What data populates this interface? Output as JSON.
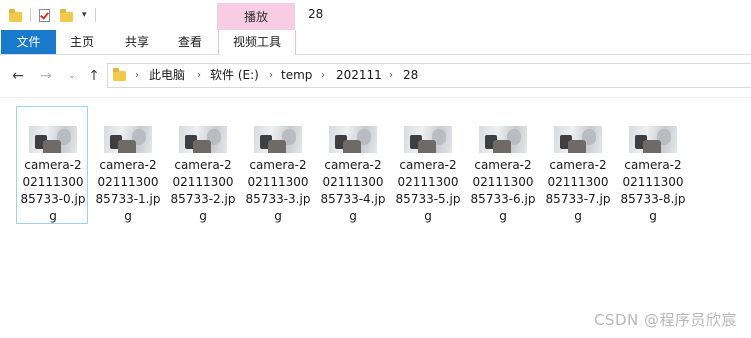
{
  "title_bar": {
    "quick_access": [
      {
        "icon": "folder-icon"
      },
      {
        "icon": "properties-check-icon"
      },
      {
        "icon": "new-folder-icon"
      },
      {
        "icon": "customize-dropdown-icon",
        "glyph": "▾"
      }
    ],
    "context_tab_group": "播放",
    "window_title": "28"
  },
  "ribbon": {
    "tabs": [
      {
        "label": "文件",
        "active": true
      },
      {
        "label": "主页"
      },
      {
        "label": "共享"
      },
      {
        "label": "查看"
      },
      {
        "label": "视频工具"
      }
    ]
  },
  "nav": {
    "back_glyph": "←",
    "forward_glyph": "→",
    "recent_glyph": "⌄",
    "up_glyph": "↑",
    "breadcrumb": [
      {
        "label": "此电脑"
      },
      {
        "label": "软件 (E:)"
      },
      {
        "label": "temp"
      },
      {
        "label": "202111"
      },
      {
        "label": "28"
      }
    ],
    "separator": "›"
  },
  "files": [
    {
      "line1": "camera-2",
      "line2": "02111300",
      "line3": "85733-0.jp",
      "line4": "g",
      "selected": true
    },
    {
      "line1": "camera-2",
      "line2": "02111300",
      "line3": "85733-1.jp",
      "line4": "g"
    },
    {
      "line1": "camera-2",
      "line2": "02111300",
      "line3": "85733-2.jp",
      "line4": "g"
    },
    {
      "line1": "camera-2",
      "line2": "02111300",
      "line3": "85733-3.jp",
      "line4": "g"
    },
    {
      "line1": "camera-2",
      "line2": "02111300",
      "line3": "85733-4.jp",
      "line4": "g"
    },
    {
      "line1": "camera-2",
      "line2": "02111300",
      "line3": "85733-5.jp",
      "line4": "g"
    },
    {
      "line1": "camera-2",
      "line2": "02111300",
      "line3": "85733-6.jp",
      "line4": "g"
    },
    {
      "line1": "camera-2",
      "line2": "02111300",
      "line3": "85733-7.jp",
      "line4": "g"
    },
    {
      "line1": "camera-2",
      "line2": "02111300",
      "line3": "85733-8.jp",
      "line4": "g"
    }
  ],
  "watermark": "CSDN @程序员欣宸",
  "colors": {
    "file_tab": "#1979ca",
    "context_tab": "#f8cde3",
    "selection_border": "#99d1ff",
    "folder": "#f3c94c"
  }
}
